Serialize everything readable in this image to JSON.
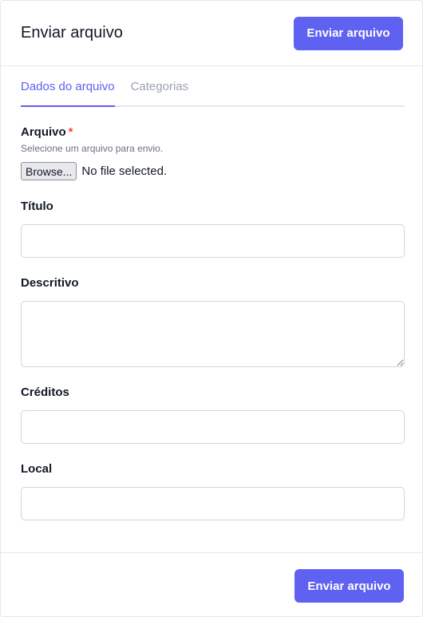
{
  "header": {
    "title": "Enviar arquivo",
    "submit_label": "Enviar arquivo"
  },
  "tabs": [
    {
      "label": "Dados do arquivo",
      "active": true
    },
    {
      "label": "Categorias",
      "active": false
    }
  ],
  "form": {
    "file": {
      "label": "Arquivo",
      "required_mark": "*",
      "hint": "Selecione um arquivo para envio.",
      "browse_label": "Browse...",
      "status": "No file selected."
    },
    "title": {
      "label": "Título",
      "value": ""
    },
    "description": {
      "label": "Descritivo",
      "value": ""
    },
    "credits": {
      "label": "Créditos",
      "value": ""
    },
    "location": {
      "label": "Local",
      "value": ""
    }
  },
  "footer": {
    "submit_label": "Enviar arquivo"
  },
  "colors": {
    "accent": "#5f61f1",
    "required": "#ef4444"
  }
}
